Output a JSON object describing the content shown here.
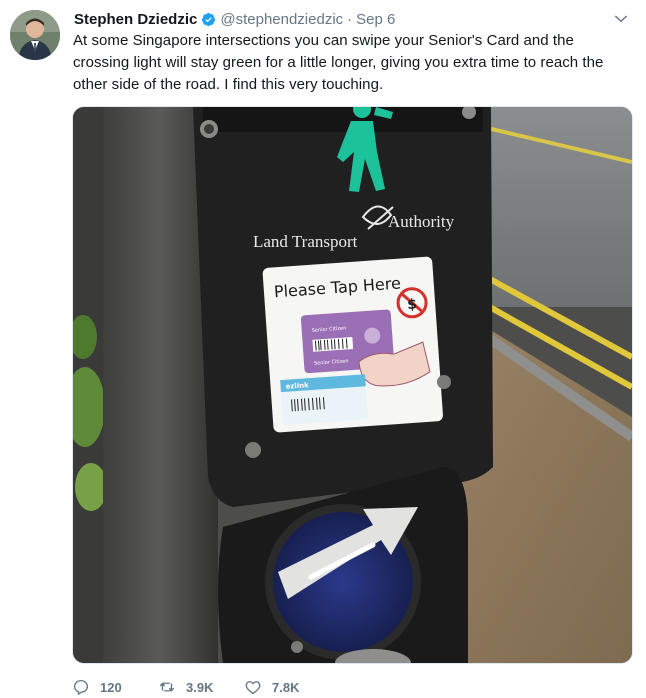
{
  "author": {
    "name": "Stephen Dziedzic",
    "handle": "@stephendziedzic",
    "separator": "·",
    "date": "Sep 6",
    "verified": true
  },
  "tweet": {
    "text": "At some Singapore intersections you can swipe your Senior's Card and the crossing light will stay green for a little longer, giving you extra time to reach the other side of the road. I find this very touching."
  },
  "media": {
    "authority_left": "Land Transport",
    "authority_right": "Authority",
    "sign_title": "Please Tap Here",
    "card_label_1": "Senior Citizen",
    "card_label_2": "Senior Citizen",
    "ezlink_label": "ezlink"
  },
  "stats": {
    "replies": "120",
    "retweets": "3.9K",
    "likes": "7.8K"
  },
  "colors": {
    "accent": "#1da1f2",
    "muted": "#657786",
    "signal_green": "#1cc39a"
  },
  "icons": [
    "verified-badge-icon",
    "caret-down-icon",
    "reply-icon",
    "retweet-icon",
    "like-icon"
  ]
}
